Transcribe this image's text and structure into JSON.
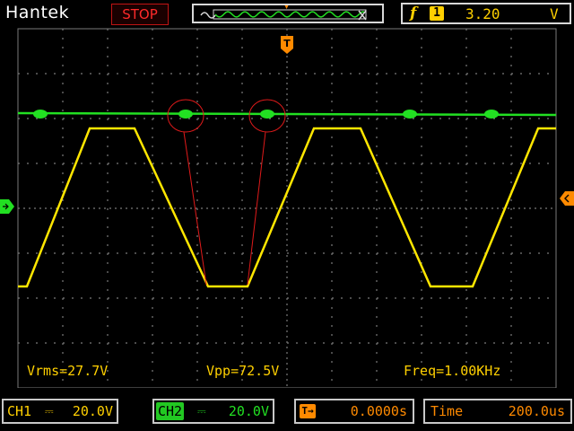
{
  "header": {
    "brand": "Hantek",
    "run_state": "STOP",
    "trigger": {
      "slope_icon": "rising-edge-icon",
      "source": "1",
      "level": "3.20",
      "unit": "V"
    }
  },
  "measurements": {
    "vrms": "Vrms=27.7V",
    "vpp": "Vpp=72.5V",
    "freq": "Freq=1.00KHz"
  },
  "channels": {
    "ch1": {
      "label": "CH1",
      "coupling": "DC",
      "scale": "20.0V",
      "color": "#ffd000"
    },
    "ch2": {
      "label": "CH2",
      "coupling": "DC",
      "scale": "20.0V",
      "color": "#22e022"
    }
  },
  "timebase": {
    "position": "0.0000s",
    "label": "Time",
    "scale": "200.0us",
    "color": "#ff8a00"
  },
  "markers": {
    "trigger_marker": "T"
  },
  "colors": {
    "grid": "#7a7a7a",
    "ch1_trace": "#ffe600",
    "ch2_trace": "#22e022",
    "annotation": "#e01a1a"
  }
}
